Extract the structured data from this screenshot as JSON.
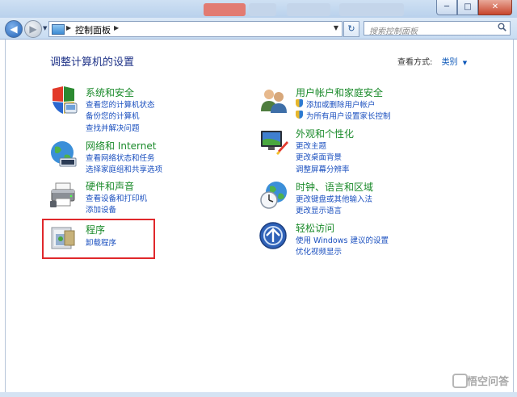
{
  "window": {
    "minimize_glyph": "─",
    "maximize_glyph": "□",
    "close_glyph": "✕"
  },
  "toolbar": {
    "back_glyph": "◀",
    "forward_glyph": "▶",
    "address": {
      "sep1": "▶",
      "path": "控制面板",
      "sep2": "▶"
    },
    "refresh_glyph": "↻",
    "search_placeholder": "搜索控制面板"
  },
  "main": {
    "title": "调整计算机的设置",
    "view_by_label": "查看方式:",
    "view_by_value": "类别"
  },
  "categories_left": [
    {
      "title": "系统和安全",
      "icon": "shield-icon",
      "links": [
        "查看您的计算机状态",
        "备份您的计算机",
        "查找并解决问题"
      ]
    },
    {
      "title": "网络和 Internet",
      "icon": "globe-network-icon",
      "links": [
        "查看网络状态和任务",
        "选择家庭组和共享选项"
      ]
    },
    {
      "title": "硬件和声音",
      "icon": "printer-icon",
      "links": [
        "查看设备和打印机",
        "添加设备"
      ]
    },
    {
      "title": "程序",
      "icon": "programs-icon",
      "links": [
        "卸载程序"
      ]
    }
  ],
  "categories_right": [
    {
      "title": "用户帐户和家庭安全",
      "icon": "users-icon",
      "links": [
        "添加或删除用户帐户",
        "为所有用户设置家长控制"
      ]
    },
    {
      "title": "外观和个性化",
      "icon": "monitor-paint-icon",
      "links": [
        "更改主题",
        "更改桌面背景",
        "调整屏幕分辨率"
      ]
    },
    {
      "title": "时钟、语言和区域",
      "icon": "clock-globe-icon",
      "links": [
        "更改键盘或其他输入法",
        "更改显示语言"
      ]
    },
    {
      "title": "轻松访问",
      "icon": "ease-of-access-icon",
      "links": [
        "使用 Windows 建议的设置",
        "优化视频显示"
      ]
    }
  ],
  "watermark": "悟空问答",
  "colors": {
    "category_title": "#1a8a2a",
    "link": "#1a4fbf",
    "highlight_box": "#e0282b"
  }
}
